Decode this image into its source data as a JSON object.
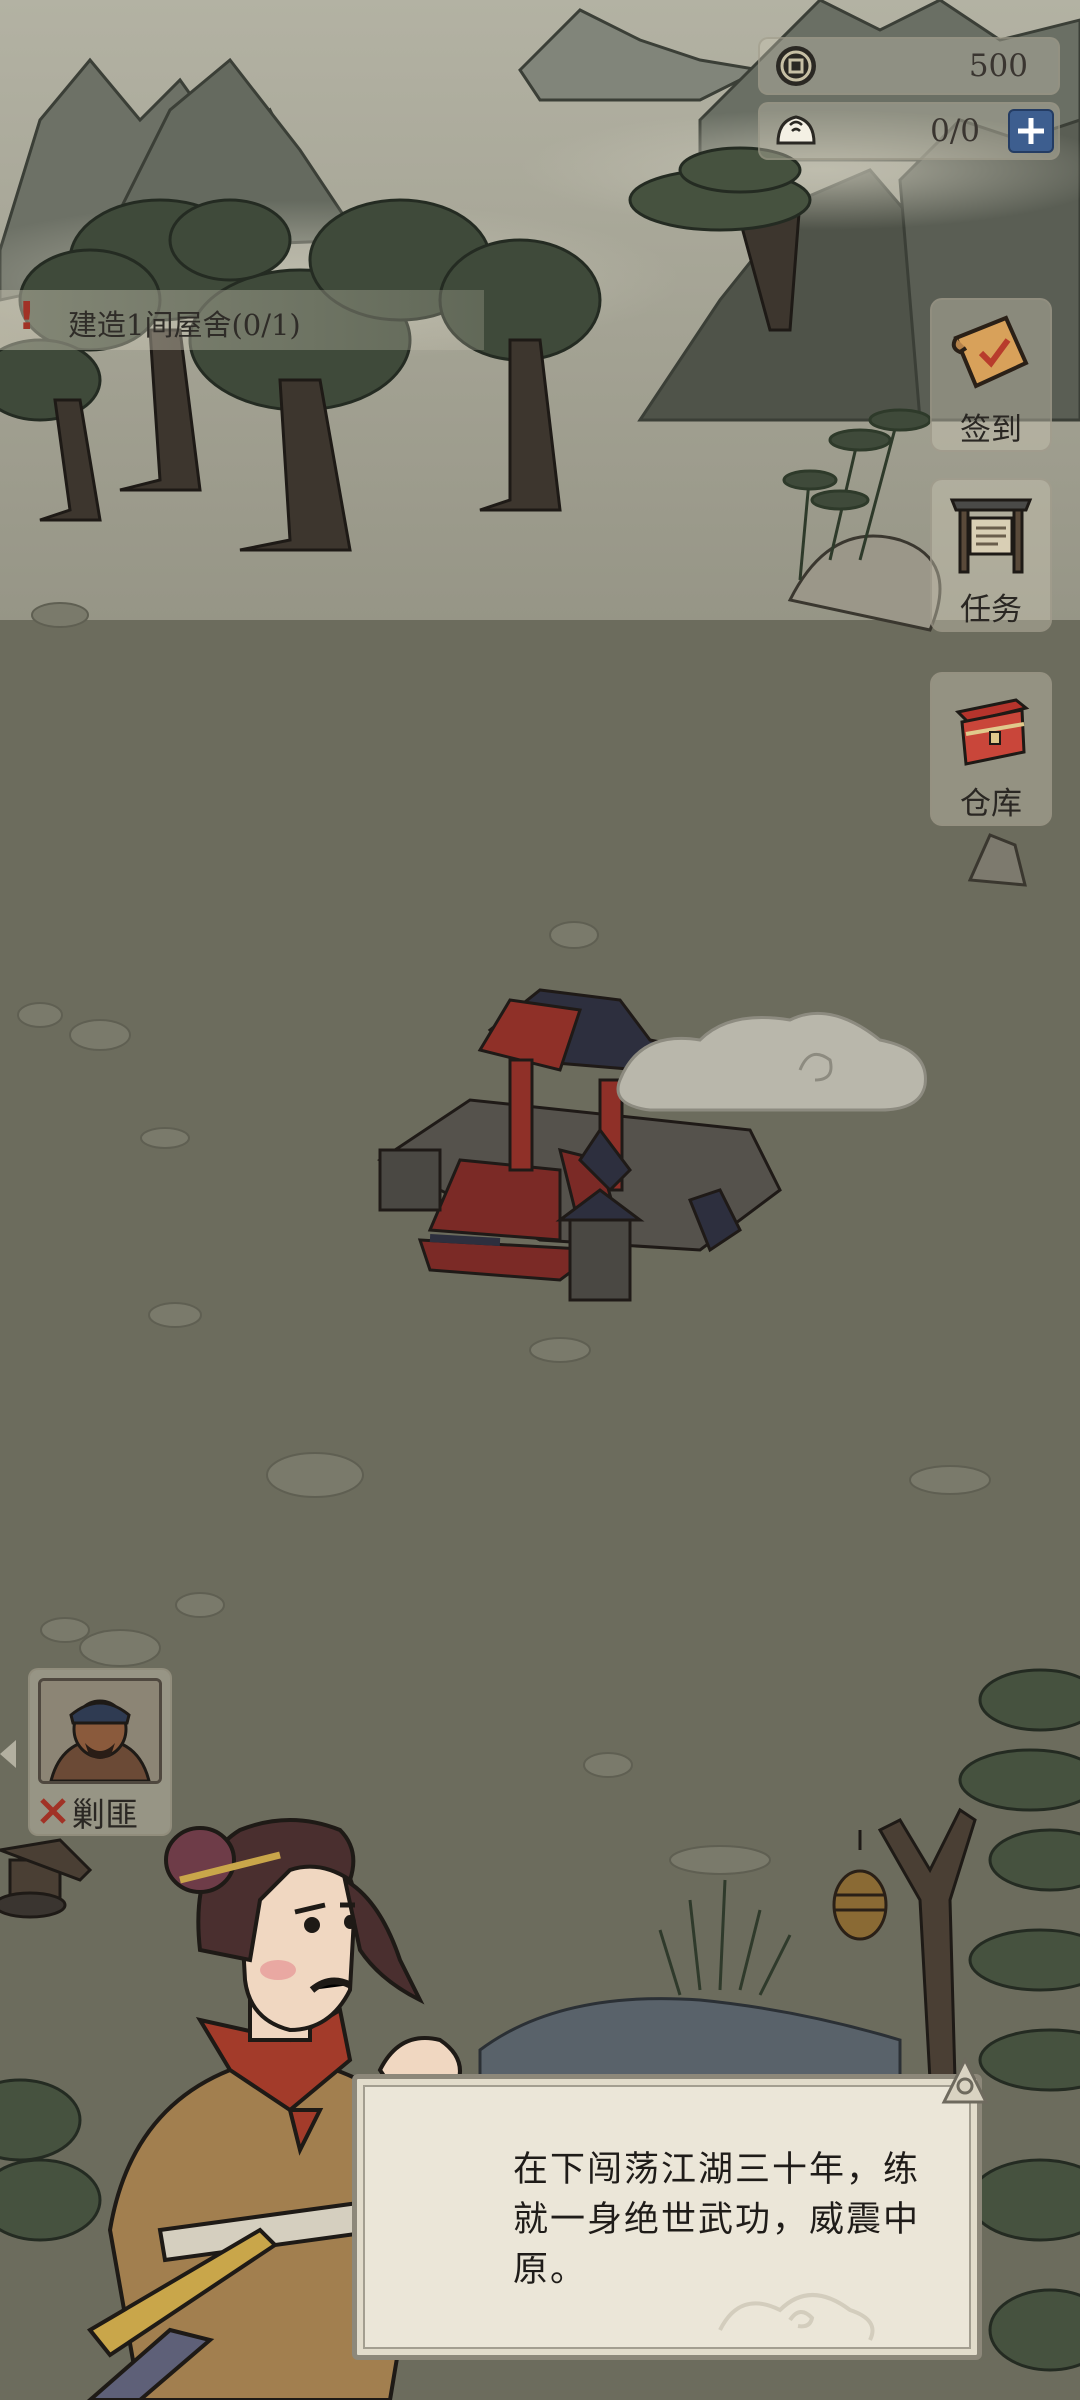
{
  "resources": {
    "coins": {
      "icon": "coin-icon",
      "value": "500"
    },
    "food": {
      "icon": "steamed-bun-icon",
      "value": "0/0",
      "add_icon": "plus-icon"
    }
  },
  "quest": {
    "icon": "exclamation-icon",
    "text": "建造1间屋舍(0/1)"
  },
  "side_menu": [
    {
      "name": "checkin",
      "icon": "scroll-icon",
      "label": "签到"
    },
    {
      "name": "tasks",
      "icon": "notice-board-icon",
      "label": "任务"
    },
    {
      "name": "warehouse",
      "icon": "chest-icon",
      "label": "仓库"
    }
  ],
  "enemy": {
    "icon": "crossed-swords-icon",
    "name": "剿匪"
  },
  "dialog": {
    "text": "在下闯荡江湖三十年，练就一身绝世武功，威震中原。"
  },
  "colors": {
    "ground": "#6f6f60",
    "panel": "#cdc8b6",
    "plus_button": "#3d5e8f",
    "alert": "#a13226",
    "dialog_bg": "#ebe6d8"
  }
}
